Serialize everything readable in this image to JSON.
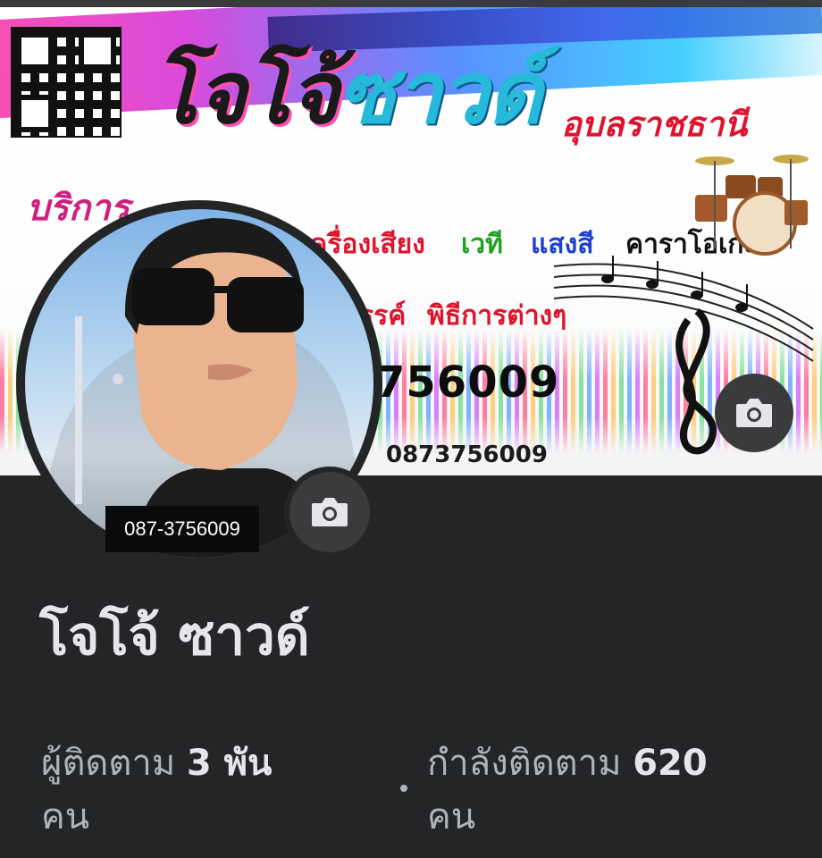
{
  "cover": {
    "brand_main": "โจโจ้",
    "brand_sub": "ซาวด์",
    "city": "อุบลราชธานี",
    "service_title": "บริการ",
    "services_line1": [
      "เครื่องเสียง",
      "เวที",
      "แสงสี",
      "คาราโอเกะ"
    ],
    "services_line2": "พิธีการต่างๆ",
    "services_line2_prefix": "รรค์",
    "phone_big": "756009",
    "phone_small": "0873756009",
    "camera_icon": "camera-icon"
  },
  "avatar": {
    "phone_label": "087-3756009",
    "camera_icon": "camera-icon"
  },
  "profile": {
    "name": "โจโจ้ ซาวด์",
    "followers_label": "ผู้ติดตาม",
    "followers_value": "3 พัน",
    "followers_unit": "คน",
    "following_label": "กำลังติดตาม",
    "following_value": "620",
    "following_unit": "คน"
  },
  "colors": {
    "background": "#242526",
    "text_primary": "#e4e6eb",
    "text_secondary": "#b0b3b8",
    "button_bg": "#3a3b3c"
  }
}
